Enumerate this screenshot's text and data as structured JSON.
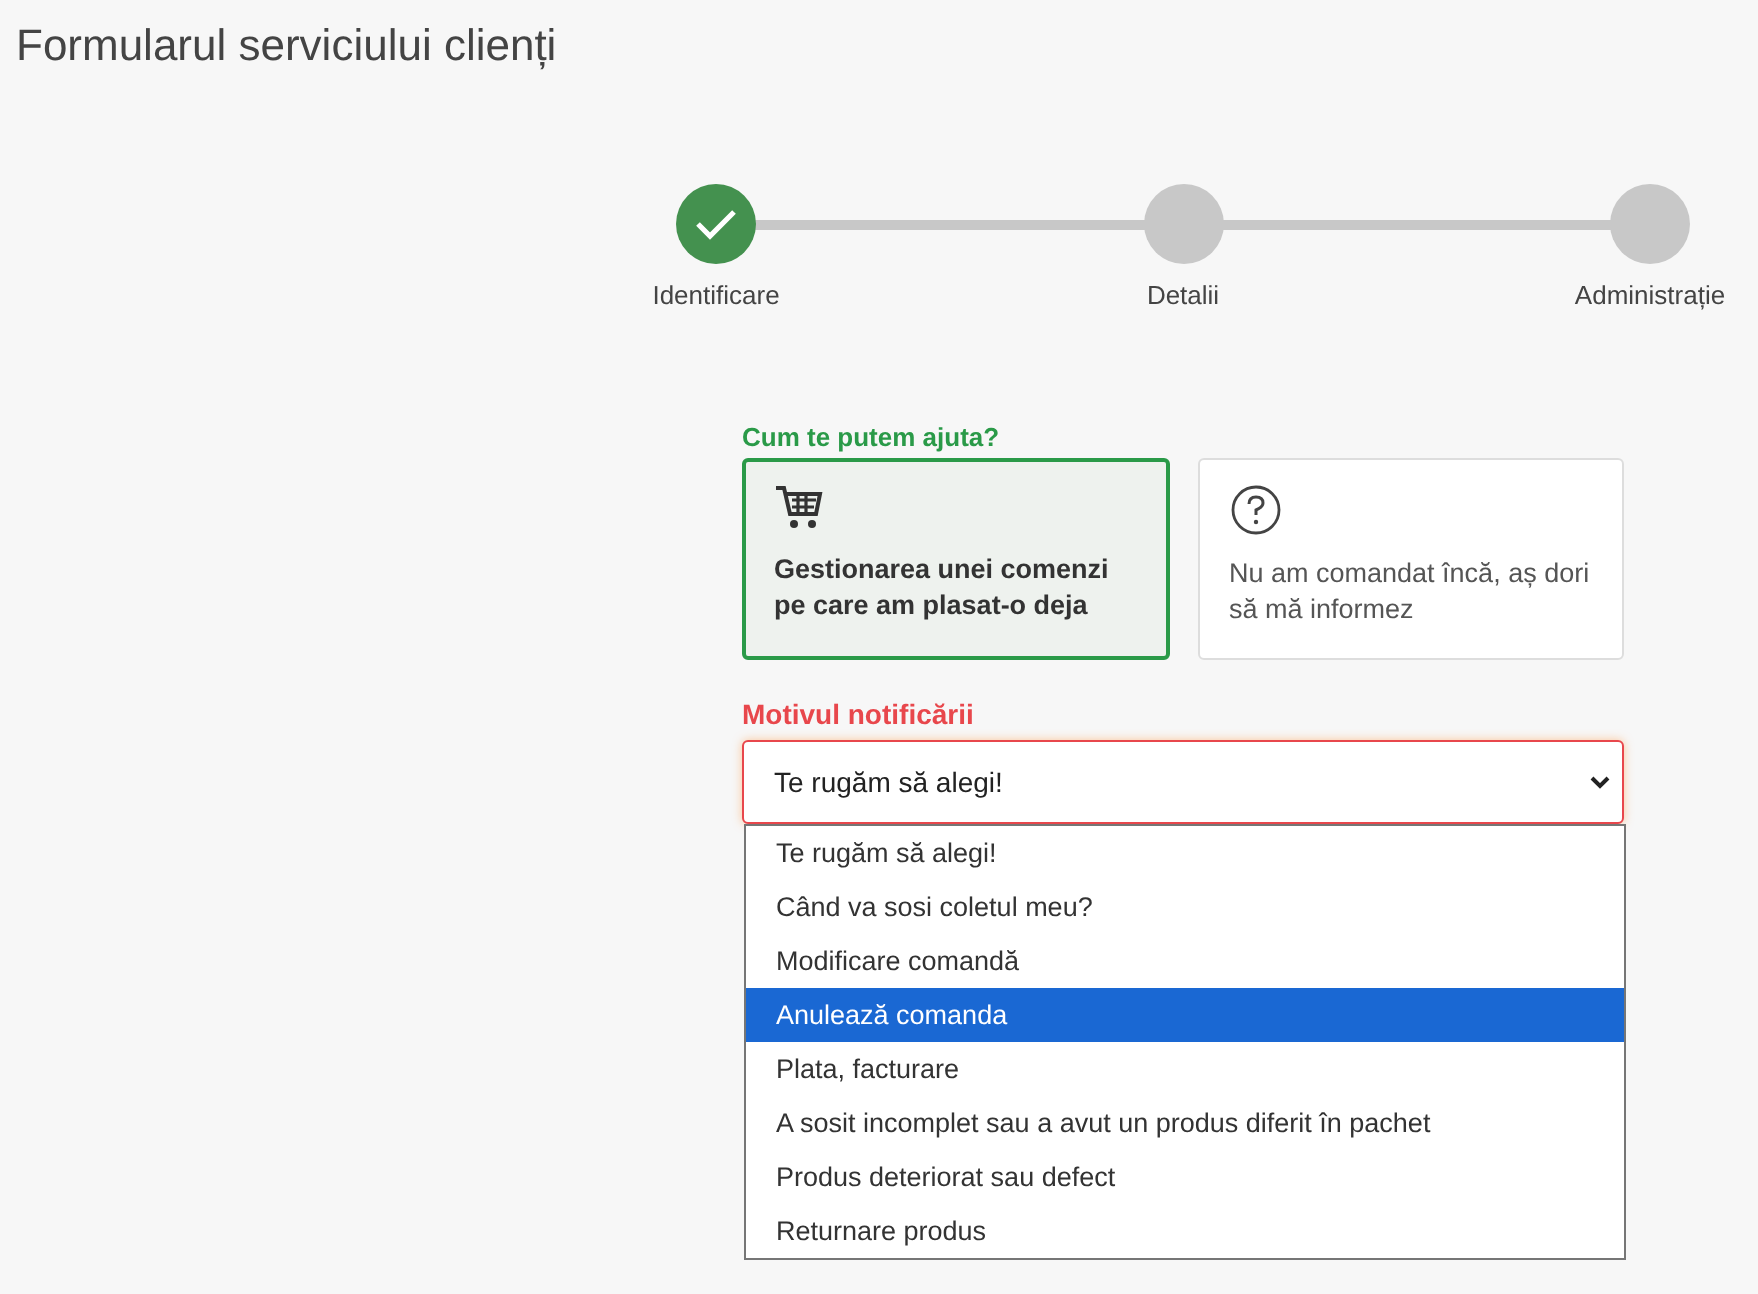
{
  "page": {
    "title": "Formularul serviciului clienți"
  },
  "steps": [
    {
      "label": "Identificare",
      "completed": true
    },
    {
      "label": "Detalii",
      "completed": false
    },
    {
      "label": "Administrație",
      "completed": false
    }
  ],
  "help": {
    "label": "Cum te putem ajuta?",
    "options": [
      {
        "kind": "cart",
        "text": "Gestionarea unei comenzi pe care am plasat-o deja",
        "selected": true
      },
      {
        "kind": "question",
        "text": "Nu am comandat încă, aș dori să mă informez",
        "selected": false
      }
    ]
  },
  "reason": {
    "label": "Motivul notificării",
    "error": true,
    "value": "Te rugăm să alegi!",
    "expanded": true,
    "options": [
      {
        "text": "Te rugăm să alegi!",
        "highlighted": false
      },
      {
        "text": "Când va sosi coletul meu?",
        "highlighted": false
      },
      {
        "text": "Modificare comandă",
        "highlighted": false
      },
      {
        "text": "Anulează comanda",
        "highlighted": true
      },
      {
        "text": "Plata, facturare",
        "highlighted": false
      },
      {
        "text": "A sosit incomplet sau a avut un produs diferit în pachet",
        "highlighted": false
      },
      {
        "text": "Produs deteriorat sau defect",
        "highlighted": false
      },
      {
        "text": "Returnare produs",
        "highlighted": false
      }
    ]
  }
}
